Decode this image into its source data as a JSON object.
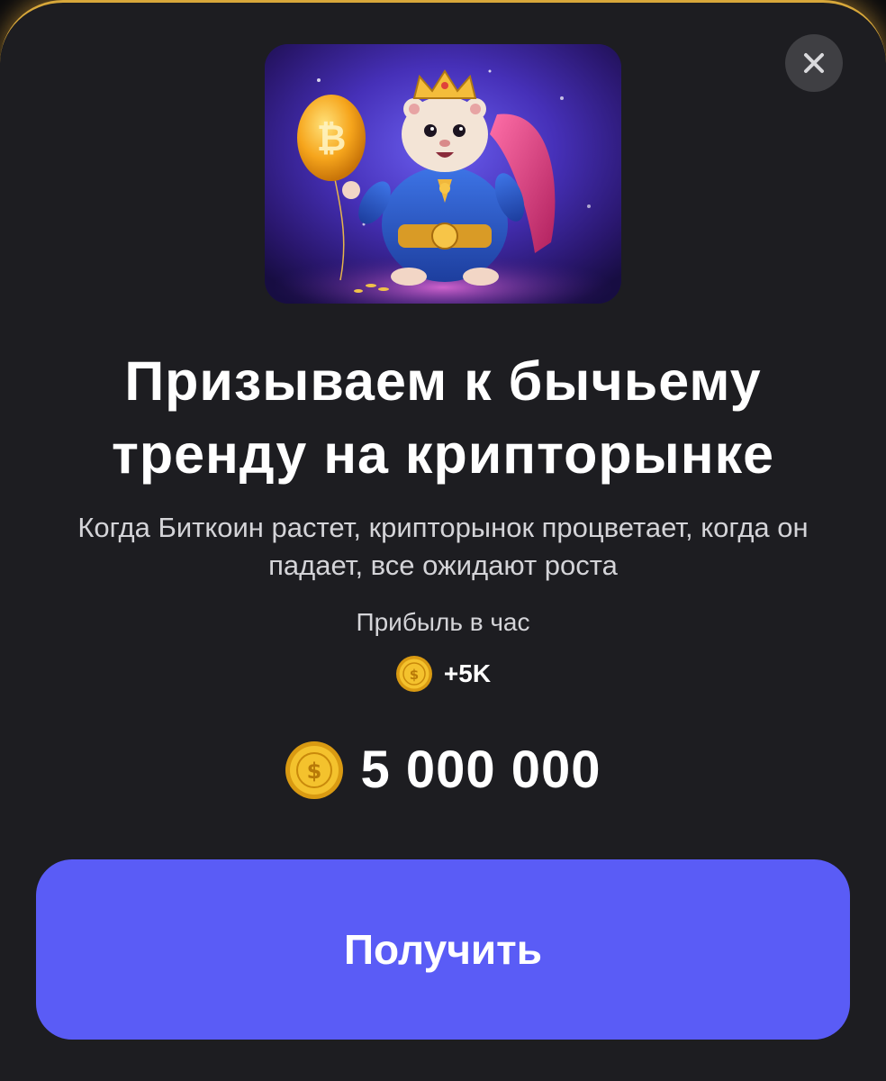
{
  "popup": {
    "title": "Призываем к бычьему тренду на крипторынке",
    "description": "Когда Биткоин растет, крипторынок процветает, когда он падает, все ожидают роста",
    "profit_label": "Прибыль в час",
    "profit_value": "+5K",
    "price": "5 000 000",
    "claim_label": "Получить"
  },
  "colors": {
    "sheet_background": "#1d1d21",
    "sheet_border_glow": "#d7a73a",
    "button_accent": "#5a5cf6",
    "coin_gold": "#f2b823",
    "close_button": "#3f3f43"
  },
  "icons": {
    "close": "close-icon",
    "coin": "coin-icon",
    "hero_image": "hamster-king-bitcoin-balloon-illustration"
  }
}
